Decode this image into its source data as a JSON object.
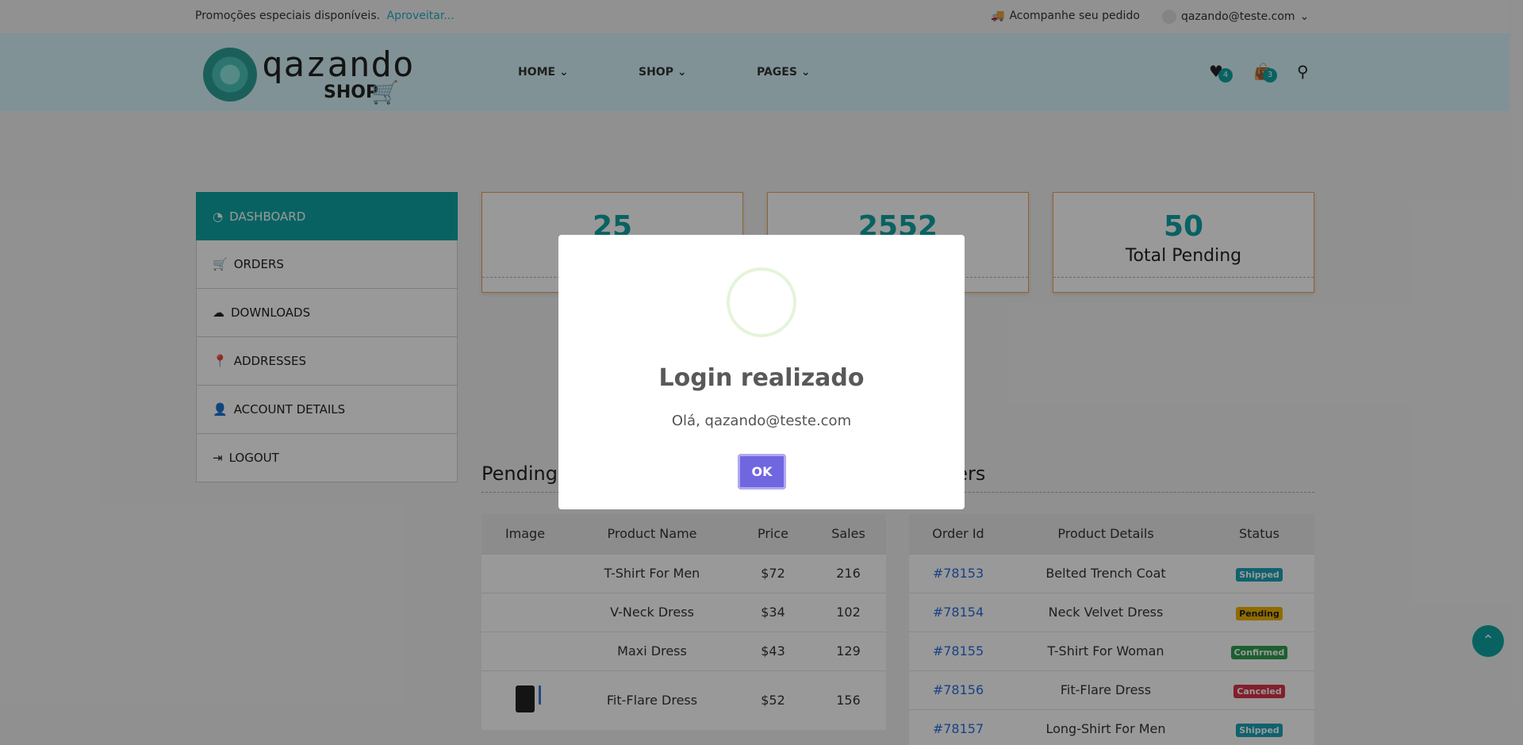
{
  "topbar": {
    "promo_text": "Promoções especiais disponíveis.",
    "promo_link": "Aproveitar...",
    "track_label": "Acompanhe seu pedido",
    "user_email": "qazando@teste.com"
  },
  "header": {
    "logo_brand": "qazando",
    "logo_sub": "SHOP",
    "nav": [
      "HOME",
      "SHOP",
      "PAGES"
    ],
    "wishlist_count": "4",
    "cart_count": "3"
  },
  "sidebar": {
    "items": [
      {
        "label": "DASHBOARD",
        "icon": "dashboard-icon"
      },
      {
        "label": "ORDERS",
        "icon": "cart-icon"
      },
      {
        "label": "DOWNLOADS",
        "icon": "cloud-download-icon"
      },
      {
        "label": "ADDRESSES",
        "icon": "map-pin-icon"
      },
      {
        "label": "ACCOUNT DETAILS",
        "icon": "user-icon"
      },
      {
        "label": "LOGOUT",
        "icon": "logout-icon"
      }
    ]
  },
  "stats": [
    {
      "value": "25",
      "label": ""
    },
    {
      "value": "2552",
      "label": ""
    },
    {
      "value": "50",
      "label": "Total Pending"
    }
  ],
  "pending": {
    "title": "Pending C",
    "headers": [
      "Image",
      "Product Name",
      "Price",
      "Sales"
    ],
    "rows": [
      {
        "name": "T-Shirt For Men",
        "price": "$72",
        "sales": "216"
      },
      {
        "name": "V-Neck Dress",
        "price": "$34",
        "sales": "102"
      },
      {
        "name": "Maxi Dress",
        "price": "$43",
        "sales": "129"
      },
      {
        "name": "Fit-Flare Dress",
        "price": "$52",
        "sales": "156"
      }
    ]
  },
  "recent": {
    "title": "ders",
    "headers": [
      "Order Id",
      "Product Details",
      "Status"
    ],
    "rows": [
      {
        "id": "#78153",
        "product": "Belted Trench Coat",
        "status": "Shipped",
        "color": "#1aa3b8"
      },
      {
        "id": "#78154",
        "product": "Neck Velvet Dress",
        "status": "Pending",
        "color": "#f0b400"
      },
      {
        "id": "#78155",
        "product": "T-Shirt For Woman",
        "status": "Confirmed",
        "color": "#2e9e4f"
      },
      {
        "id": "#78156",
        "product": "Fit-Flare Dress",
        "status": "Canceled",
        "color": "#d9344a"
      },
      {
        "id": "#78157",
        "product": "Long-Shirt For Men",
        "status": "Shipped",
        "color": "#1aa3b8"
      }
    ]
  },
  "modal": {
    "title": "Login realizado",
    "text": "Olá, qazando@teste.com",
    "ok_label": "OK"
  }
}
